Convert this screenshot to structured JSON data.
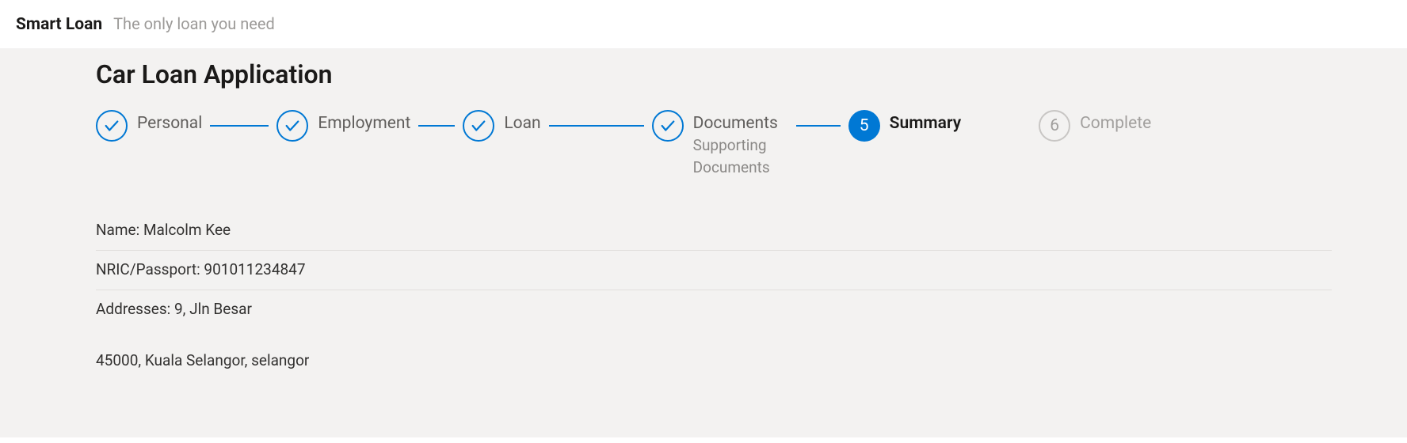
{
  "header": {
    "logo": "Smart Loan",
    "tagline": "The only loan you need"
  },
  "page": {
    "title": "Car Loan Application"
  },
  "steps": [
    {
      "label": "Personal",
      "state": "done",
      "sub": ""
    },
    {
      "label": "Employment",
      "state": "done",
      "sub": ""
    },
    {
      "label": "Loan",
      "state": "done",
      "sub": ""
    },
    {
      "label": "Documents",
      "state": "done",
      "sub": "Supporting Documents"
    },
    {
      "label": "Summary",
      "state": "current",
      "number": "5",
      "sub": ""
    },
    {
      "label": "Complete",
      "state": "upcoming",
      "number": "6",
      "sub": ""
    }
  ],
  "summary": {
    "rows": [
      {
        "text": "Name: Malcolm Kee"
      },
      {
        "text": "NRIC/Passport: 901011234847"
      },
      {
        "text": "Addresses: 9, Jln Besar"
      }
    ],
    "extra": "45000, Kuala Selangor, selangor"
  },
  "colors": {
    "accent": "#0078d4",
    "bg": "#f3f2f1",
    "muted": "#a19f9d"
  }
}
